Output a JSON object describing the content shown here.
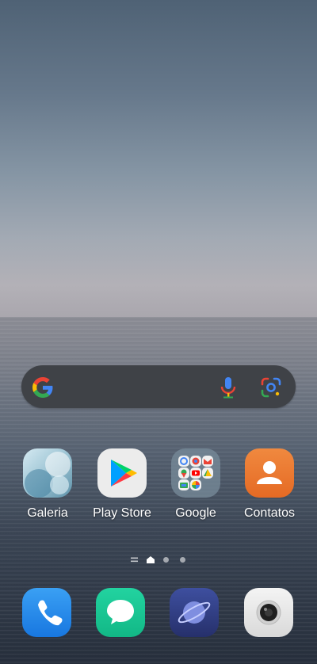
{
  "search_bar": {
    "google_logo": "google-g-icon",
    "mic": "microphone-icon",
    "lens": "google-lens-icon"
  },
  "home_apps": [
    {
      "label": "Galeria",
      "icon": "gallery-icon"
    },
    {
      "label": "Play Store",
      "icon": "play-store-icon"
    },
    {
      "label": "Google",
      "icon": "google-folder-icon"
    },
    {
      "label": "Contatos",
      "icon": "contacts-icon"
    }
  ],
  "page_indicator": {
    "pages": 3,
    "current": 1
  },
  "dock": [
    {
      "icon": "phone-icon"
    },
    {
      "icon": "messages-icon"
    },
    {
      "icon": "browser-icon"
    },
    {
      "icon": "camera-icon"
    }
  ]
}
